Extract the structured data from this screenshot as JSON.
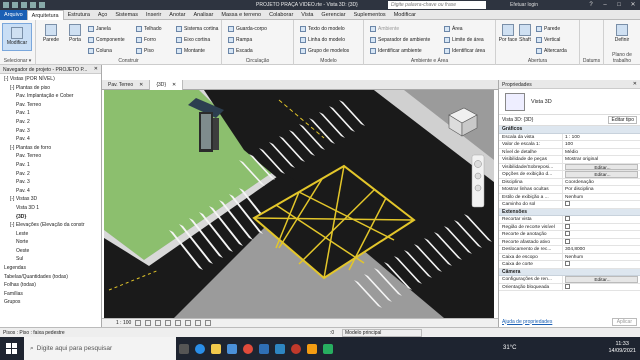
{
  "titlebar": {
    "title": "PROJETO PRAÇA VIDEO.rte - Vista 3D: {3D}",
    "search_placeholder": "Digite palavra-chave ou frase",
    "user": "Efetuar login",
    "help": "?"
  },
  "tabs": [
    "Arquivo",
    "Arquitetura",
    "Estrutura",
    "Aço",
    "Sistemas",
    "Inserir",
    "Anotar",
    "Analisar",
    "Massa e terreno",
    "Colaborar",
    "Vista",
    "Gerenciar",
    "Suplementos",
    "Modificar"
  ],
  "ribbon": {
    "modify": "Modificar",
    "select": "Selecionar ▾",
    "build_big": [
      "Parede",
      "Porta"
    ],
    "build_small": [
      "Janela",
      "Componente",
      "Coluna",
      "Telhado",
      "Forro",
      "Piso",
      "Sistema cortina",
      "Eixo cortina",
      "Montante"
    ],
    "build_label": "Construir",
    "circ": [
      "Guarda-corpo",
      "Rampa",
      "Escada"
    ],
    "circ_label": "Circulação",
    "model": [
      "Texto do modelo",
      "Linha do modelo",
      "Grupo de modelos"
    ],
    "model_label": "Modelo",
    "room": [
      "Ambiente",
      "Separador de ambiente",
      "Identificar ambiente",
      "Área",
      "Limite de área",
      "Identificar área"
    ],
    "room_label": "Ambiente e Área",
    "open_big": [
      "Por face",
      "Shaft"
    ],
    "open_small": [
      "Parede",
      "Vertical",
      "Altercarda"
    ],
    "open_label": "Abertura",
    "datum": "Datums",
    "workplane_big": "Definir",
    "workplane_label": "Plano de trabalho"
  },
  "project_browser": {
    "title": "Navegador de projeto - PROJETO P...",
    "items": [
      "[-] Vistas (POR NÍVEL)",
      "[-] Plantas de piso",
      "Pav. Implantação e Cober",
      "Pav. Terreo",
      "Pav. 1",
      "Pav. 2",
      "Pav. 3",
      "Pav. 4",
      "[-] Plantas de forro",
      "Pav. Terreo",
      "Pav. 1",
      "Pav. 2",
      "Pav. 3",
      "Pav. 4",
      "[-] Vistas 3D",
      "Vista 3D 1",
      "{3D}",
      "[-] Elevações (Elevação da constr",
      "Leste",
      "Norte",
      "Oeste",
      "Sul",
      "Legendas",
      "Tabelas/Quantidades (todas)",
      "Folhas (todas)",
      "Famílias",
      "Grupos"
    ],
    "indent": [
      1,
      2,
      3,
      3,
      3,
      3,
      3,
      3,
      2,
      3,
      3,
      3,
      3,
      3,
      2,
      3,
      3,
      2,
      3,
      3,
      3,
      3,
      1,
      1,
      1,
      1,
      1
    ]
  },
  "view_tabs": [
    "Pav. Terreo",
    "{3D}"
  ],
  "view_bar": {
    "scale": "1 : 100"
  },
  "properties": {
    "title": "Propriedades",
    "type": "Vista 3D",
    "selector": "Vista 3D: {3D}",
    "edit_type": "Editar tipo",
    "sections": [
      {
        "name": "Gráficos",
        "rows": [
          [
            "Escala da vista",
            "1 : 100",
            0
          ],
          [
            "Valor de escala   1:",
            "100",
            0
          ],
          [
            "Nível de detalhe",
            "Médio",
            0
          ],
          [
            "Visibilidade de peças",
            "Mostrar original",
            0
          ],
          [
            "Visibilidade/Sobreposi...",
            "Editar...",
            1
          ],
          [
            "Opções de exibição d...",
            "Editar...",
            1
          ],
          [
            "Disciplina",
            "Coordenação",
            0
          ],
          [
            "Mostrar linhas ocultas",
            "Por disciplina",
            0
          ],
          [
            "Estilo de exibição a ...",
            "Nenhum",
            0
          ],
          [
            "Caminho do sol",
            "",
            2
          ]
        ]
      },
      {
        "name": "Extensões",
        "rows": [
          [
            "Recortar vista",
            "",
            2
          ],
          [
            "Região de recorte visível",
            "",
            2
          ],
          [
            "Recorte de anotação",
            "",
            2
          ],
          [
            "Recorte afastado ativo",
            "",
            2
          ],
          [
            "Deslocamento de rec...",
            "304,8000",
            0
          ],
          [
            "Caixa de escopo",
            "Nenhum",
            0
          ],
          [
            "Caixa de corte",
            "",
            2
          ]
        ]
      },
      {
        "name": "Câmera",
        "rows": [
          [
            "Configurações de ren...",
            "Editar...",
            1
          ],
          [
            "Orientação bloqueada",
            "",
            2
          ]
        ]
      }
    ],
    "help_link": "Ajuda de propriedades",
    "apply": "Aplicar"
  },
  "status": {
    "left": "Pisos : Piso : faixa pedestre",
    "zero": ":0",
    "model": "Modelo principal"
  },
  "taskbar": {
    "search": "Digite aqui para pesquisar",
    "weather": "31°C",
    "time": "11:33",
    "date": "14/09/2021"
  }
}
